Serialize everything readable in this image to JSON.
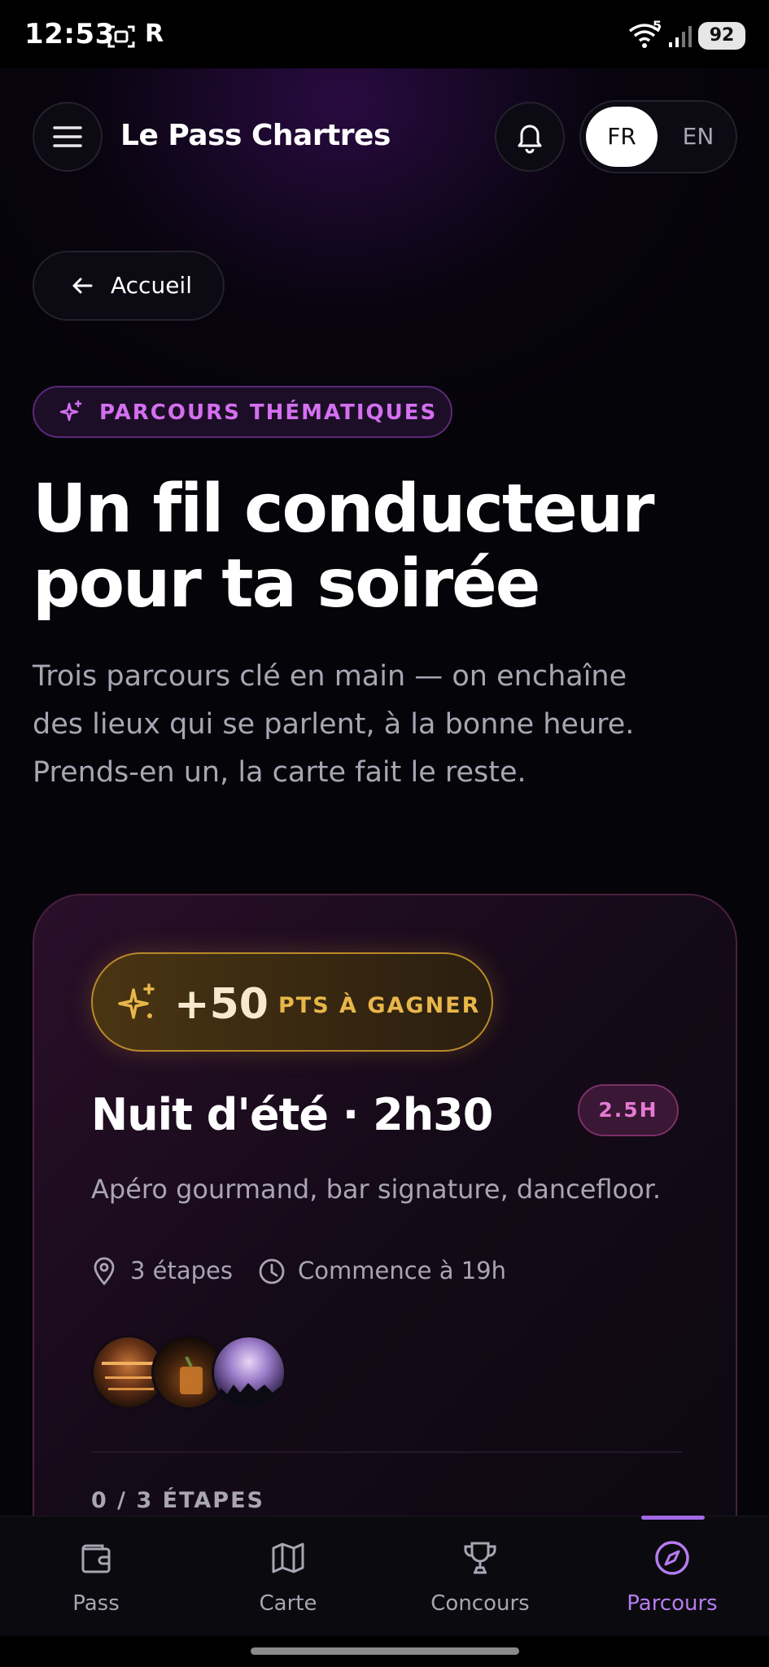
{
  "status_bar": {
    "time": "12:53",
    "carrier_badge": "R",
    "wifi_badge": "5",
    "battery": "92"
  },
  "header": {
    "title": "Le Pass Chartres",
    "lang_active": "FR",
    "lang_other": "EN"
  },
  "back": {
    "label": "Accueil"
  },
  "section_badge": "PARCOURS THÉMATIQUES",
  "hero": {
    "line1": "Un fil conducteur",
    "line2": "pour ta soirée"
  },
  "subtitle": "Trois parcours clé en main — on enchaîne des lieux qui se parlent, à la bonne heure. Prends-en un, la carte fait le reste.",
  "card": {
    "points_value": "+50",
    "points_label": "PTS À GAGNER",
    "title": "Nuit d'été · 2h30",
    "duration": "2.5H",
    "description": "Apéro gourmand, bar signature, dancefloor.",
    "stops": "3 étapes",
    "start": "Commence à 19h",
    "progress": "0 / 3 ÉTAPES",
    "progress_fraction": 0
  },
  "nav": [
    {
      "label": "Pass",
      "icon": "wallet-icon"
    },
    {
      "label": "Carte",
      "icon": "map-icon"
    },
    {
      "label": "Concours",
      "icon": "trophy-icon"
    },
    {
      "label": "Parcours",
      "icon": "compass-icon",
      "active": true
    }
  ],
  "colors": {
    "accent": "#b57cf0",
    "badge_pink": "#d46ff0",
    "gold": "#e8b64a",
    "bg": "#050409"
  }
}
